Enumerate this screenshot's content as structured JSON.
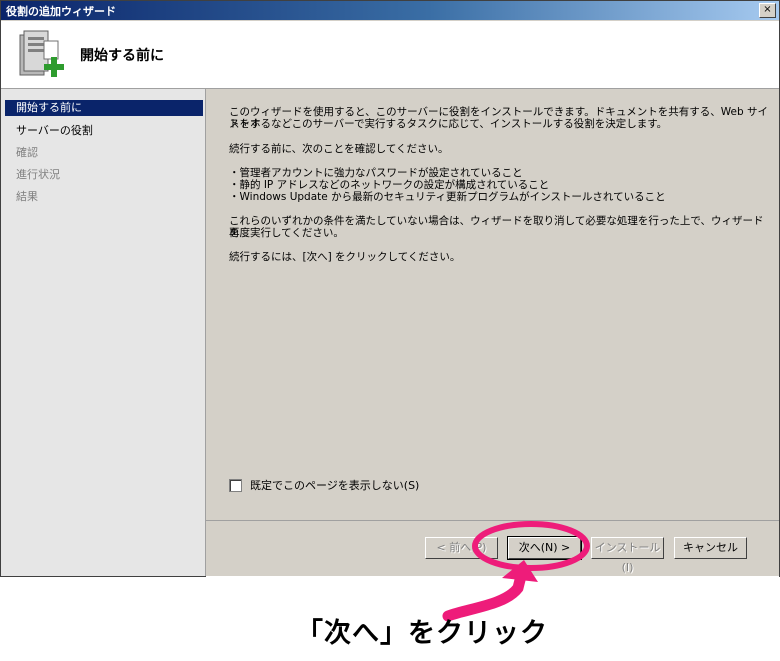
{
  "window": {
    "title": "役割の追加ウィザード",
    "close_glyph": "×"
  },
  "header": {
    "title": "開始する前に",
    "icon": "server-add-icon"
  },
  "sidebar": {
    "items": [
      {
        "label": "開始する前に",
        "state": "active"
      },
      {
        "label": "サーバーの役割",
        "state": "normal"
      },
      {
        "label": "確認",
        "state": "disabled"
      },
      {
        "label": "進行状況",
        "state": "disabled"
      },
      {
        "label": "結果",
        "state": "disabled"
      }
    ]
  },
  "content": {
    "intro_1": "このウィザードを使用すると、このサーバーに役割をインストールできます。ドキュメントを共有する、Web サイトをホ",
    "intro_2": "ストするなどこのサーバーで実行するタスクに応じて、インストールする役割を決定します。",
    "confirm_lead": "続行する前に、次のことを確認してください。",
    "bullets": [
      "・管理者アカウントに強力なパスワードが設定されていること",
      "・静的 IP アドレスなどのネットワークの設定が構成されていること",
      "・Windows Update から最新のセキュリティ更新プログラムがインストールされていること"
    ],
    "cancel_note_1": "これらのいずれかの条件を満たしていない場合は、ウィザードを取り消して必要な処理を行った上で、ウィザードを",
    "cancel_note_2": "再度実行してください。",
    "continue_note": "続行するには、[次へ] をクリックしてください。",
    "skip_checkbox_label": "既定でこのページを表示しない(S)",
    "skip_checked": false
  },
  "buttons": {
    "back": "< 前へ(P)",
    "next": "次へ(N) >",
    "install": "インストール(I)",
    "cancel": "キャンセル"
  },
  "annotation": {
    "caption": "「次へ」をクリック",
    "color": "#ee1c7a"
  }
}
